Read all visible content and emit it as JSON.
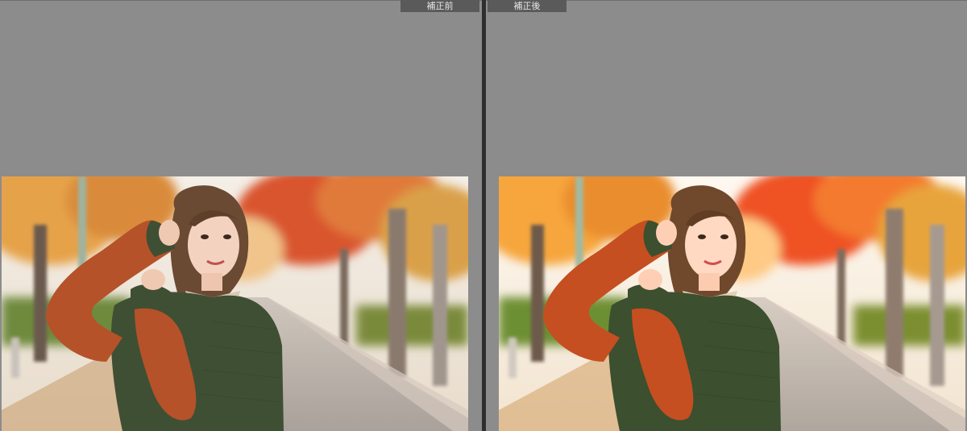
{
  "compare": {
    "before_label": "補正前",
    "after_label": "補正後"
  },
  "photo": {
    "subject": "woman-in-autumn-park",
    "colors": {
      "sky": "#f2ede6",
      "foliage_red": "#d9552f",
      "foliage_orange": "#e8973a",
      "sweater_green": "#3f4f34",
      "sleeve_rust": "#b5522a",
      "road": "#b9b1aa"
    }
  }
}
